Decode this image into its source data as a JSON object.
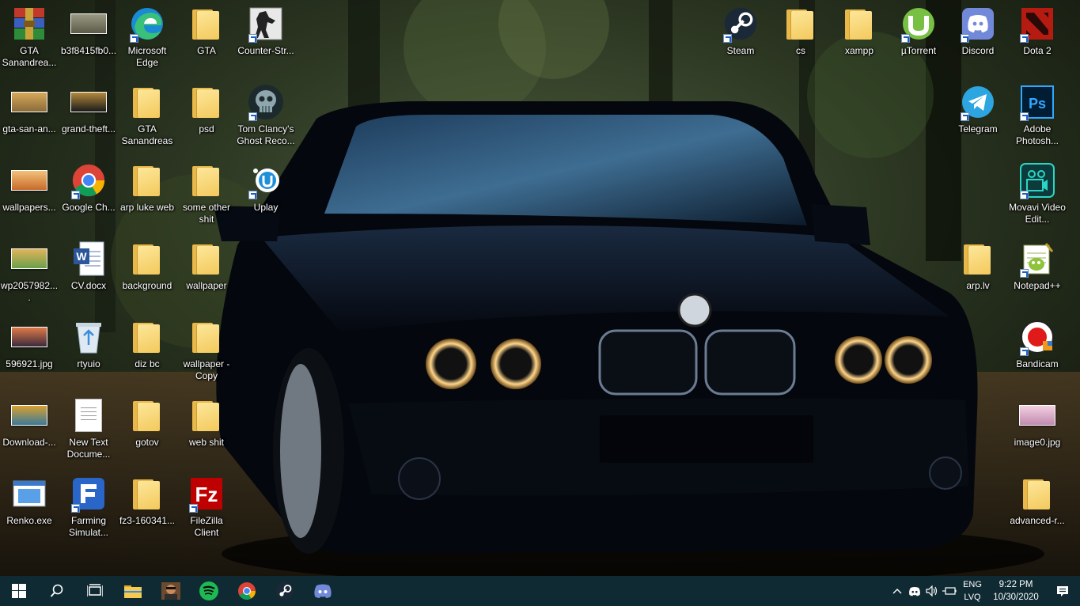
{
  "desktop": {
    "icons": [
      {
        "label": "GTA Sanandrea...",
        "type": "rar"
      },
      {
        "label": "b3f8415fb0...",
        "type": "image"
      },
      {
        "label": "Microsoft Edge",
        "type": "edge"
      },
      {
        "label": "GTA",
        "type": "folder"
      },
      {
        "label": "Counter-Str...",
        "type": "cs"
      },
      {
        "label": "gta-san-an...",
        "type": "image"
      },
      {
        "label": "grand-theft...",
        "type": "image"
      },
      {
        "label": "GTA Sanandreas",
        "type": "folder"
      },
      {
        "label": "psd",
        "type": "folder"
      },
      {
        "label": "Tom Clancy's Ghost Reco...",
        "type": "ghost"
      },
      {
        "label": "wallpapers...",
        "type": "image"
      },
      {
        "label": "Google Ch...",
        "type": "chrome"
      },
      {
        "label": "arp luke web",
        "type": "folder"
      },
      {
        "label": "some other shit",
        "type": "folder"
      },
      {
        "label": "Uplay",
        "type": "uplay"
      },
      {
        "label": "wp2057982....",
        "type": "image"
      },
      {
        "label": "CV.docx",
        "type": "word"
      },
      {
        "label": "background",
        "type": "folder"
      },
      {
        "label": "wallpaper",
        "type": "folder"
      },
      {
        "label": "596921.jpg",
        "type": "image"
      },
      {
        "label": "rtyuio",
        "type": "recycle"
      },
      {
        "label": "diz bc",
        "type": "folder"
      },
      {
        "label": "wallpaper - Copy",
        "type": "folder"
      },
      {
        "label": "Download-...",
        "type": "image"
      },
      {
        "label": "New Text Docume...",
        "type": "text"
      },
      {
        "label": "gotov",
        "type": "folder"
      },
      {
        "label": "web shit",
        "type": "folder"
      },
      {
        "label": "Renko.exe",
        "type": "exe"
      },
      {
        "label": "Farming Simulat...",
        "type": "farming"
      },
      {
        "label": "fz3-160341...",
        "type": "folder"
      },
      {
        "label": "FileZilla Client",
        "type": "filezilla"
      },
      {
        "label": "Steam",
        "type": "steam"
      },
      {
        "label": "cs",
        "type": "folder"
      },
      {
        "label": "xampp",
        "type": "folder"
      },
      {
        "label": "µTorrent",
        "type": "utorrent"
      },
      {
        "label": "Discord",
        "type": "discord"
      },
      {
        "label": "Dota 2",
        "type": "dota"
      },
      {
        "label": "Telegram",
        "type": "telegram"
      },
      {
        "label": "Adobe Photosh...",
        "type": "photoshop"
      },
      {
        "label": "Movavi Video Edit...",
        "type": "movavi"
      },
      {
        "label": "arp.lv",
        "type": "folder"
      },
      {
        "label": "Notepad++",
        "type": "notepadpp"
      },
      {
        "label": "Bandicam",
        "type": "bandicam"
      },
      {
        "label": "image0.jpg",
        "type": "image"
      },
      {
        "label": "advanced-r...",
        "type": "folder"
      }
    ]
  },
  "taskbar": {
    "pinned": [
      {
        "name": "windows-start",
        "icon": "windows-icon"
      },
      {
        "name": "search",
        "icon": "search-icon"
      },
      {
        "name": "task-view",
        "icon": "task-view-icon"
      },
      {
        "name": "file-explorer",
        "icon": "file-explorer-icon"
      },
      {
        "name": "gta-san-andreas",
        "icon": "gta-icon"
      },
      {
        "name": "spotify",
        "icon": "spotify-icon"
      },
      {
        "name": "chrome",
        "icon": "chrome-icon"
      },
      {
        "name": "steam",
        "icon": "steam-icon"
      },
      {
        "name": "discord",
        "icon": "discord-icon"
      }
    ],
    "tray": {
      "language_top": "ENG",
      "language_bottom": "LVQ",
      "time": "9:22 PM",
      "date": "10/30/2020"
    }
  },
  "colors": {
    "taskbar_bg": "#0f2a32",
    "label_text": "#ffffff",
    "folder": "#f3c95c"
  }
}
